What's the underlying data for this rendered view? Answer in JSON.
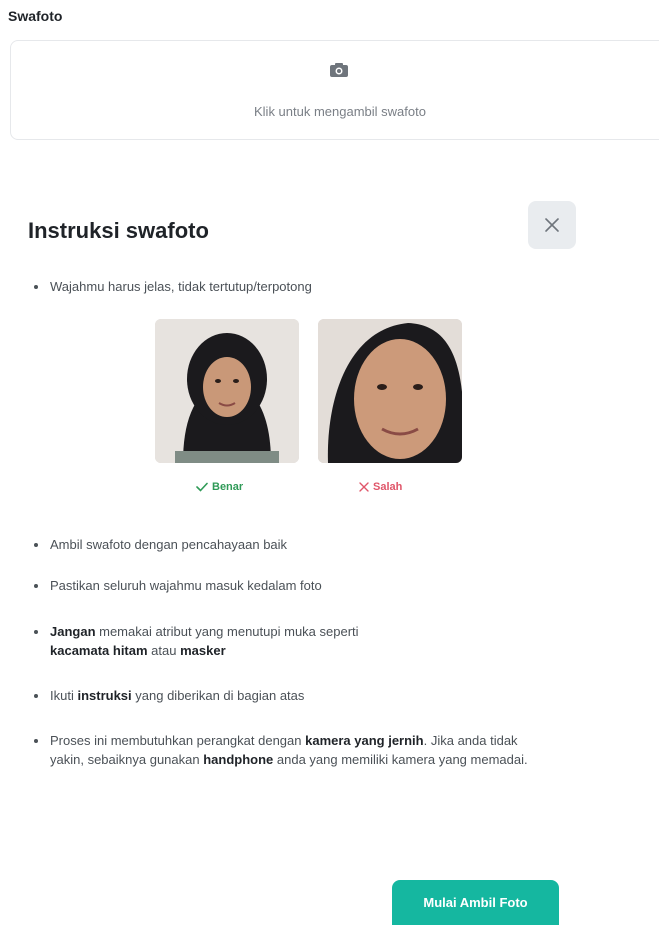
{
  "field": {
    "label": "Swafoto",
    "upload_hint": "Klik untuk mengambil swafoto",
    "upload_icon": "camera-icon"
  },
  "modal": {
    "title": "Instruksi swafoto",
    "close_icon": "close-icon",
    "instruction_1": "Wajahmu harus jelas, tidak tertutup/terpotong",
    "example_good_label": "Benar",
    "example_bad_label": "Salah",
    "instruction_2": "Ambil swafoto dengan pencahayaan baik",
    "instruction_3": "Pastikan seluruh wajahmu masuk kedalam foto",
    "instruction_4": {
      "b1": "Jangan",
      "t1": " memakai atribut yang menutupi muka seperti ",
      "b2": "kacamata hitam",
      "t2": " atau ",
      "b3": "masker"
    },
    "instruction_5": {
      "t1": "Ikuti ",
      "b1": "instruksi",
      "t2": " yang diberikan di bagian atas"
    },
    "instruction_6": {
      "t1": "Proses ini membutuhkan perangkat dengan ",
      "b1": "kamera yang jernih",
      "t2": ". Jika anda tidak yakin, sebaiknya gunakan ",
      "b2": "handphone",
      "t3": " anda yang memiliki kamera yang memadai."
    },
    "cta_label": "Mulai Ambil Foto"
  },
  "colors": {
    "accent": "#15b7a0",
    "good": "#2f9a57",
    "bad": "#e0566a"
  }
}
